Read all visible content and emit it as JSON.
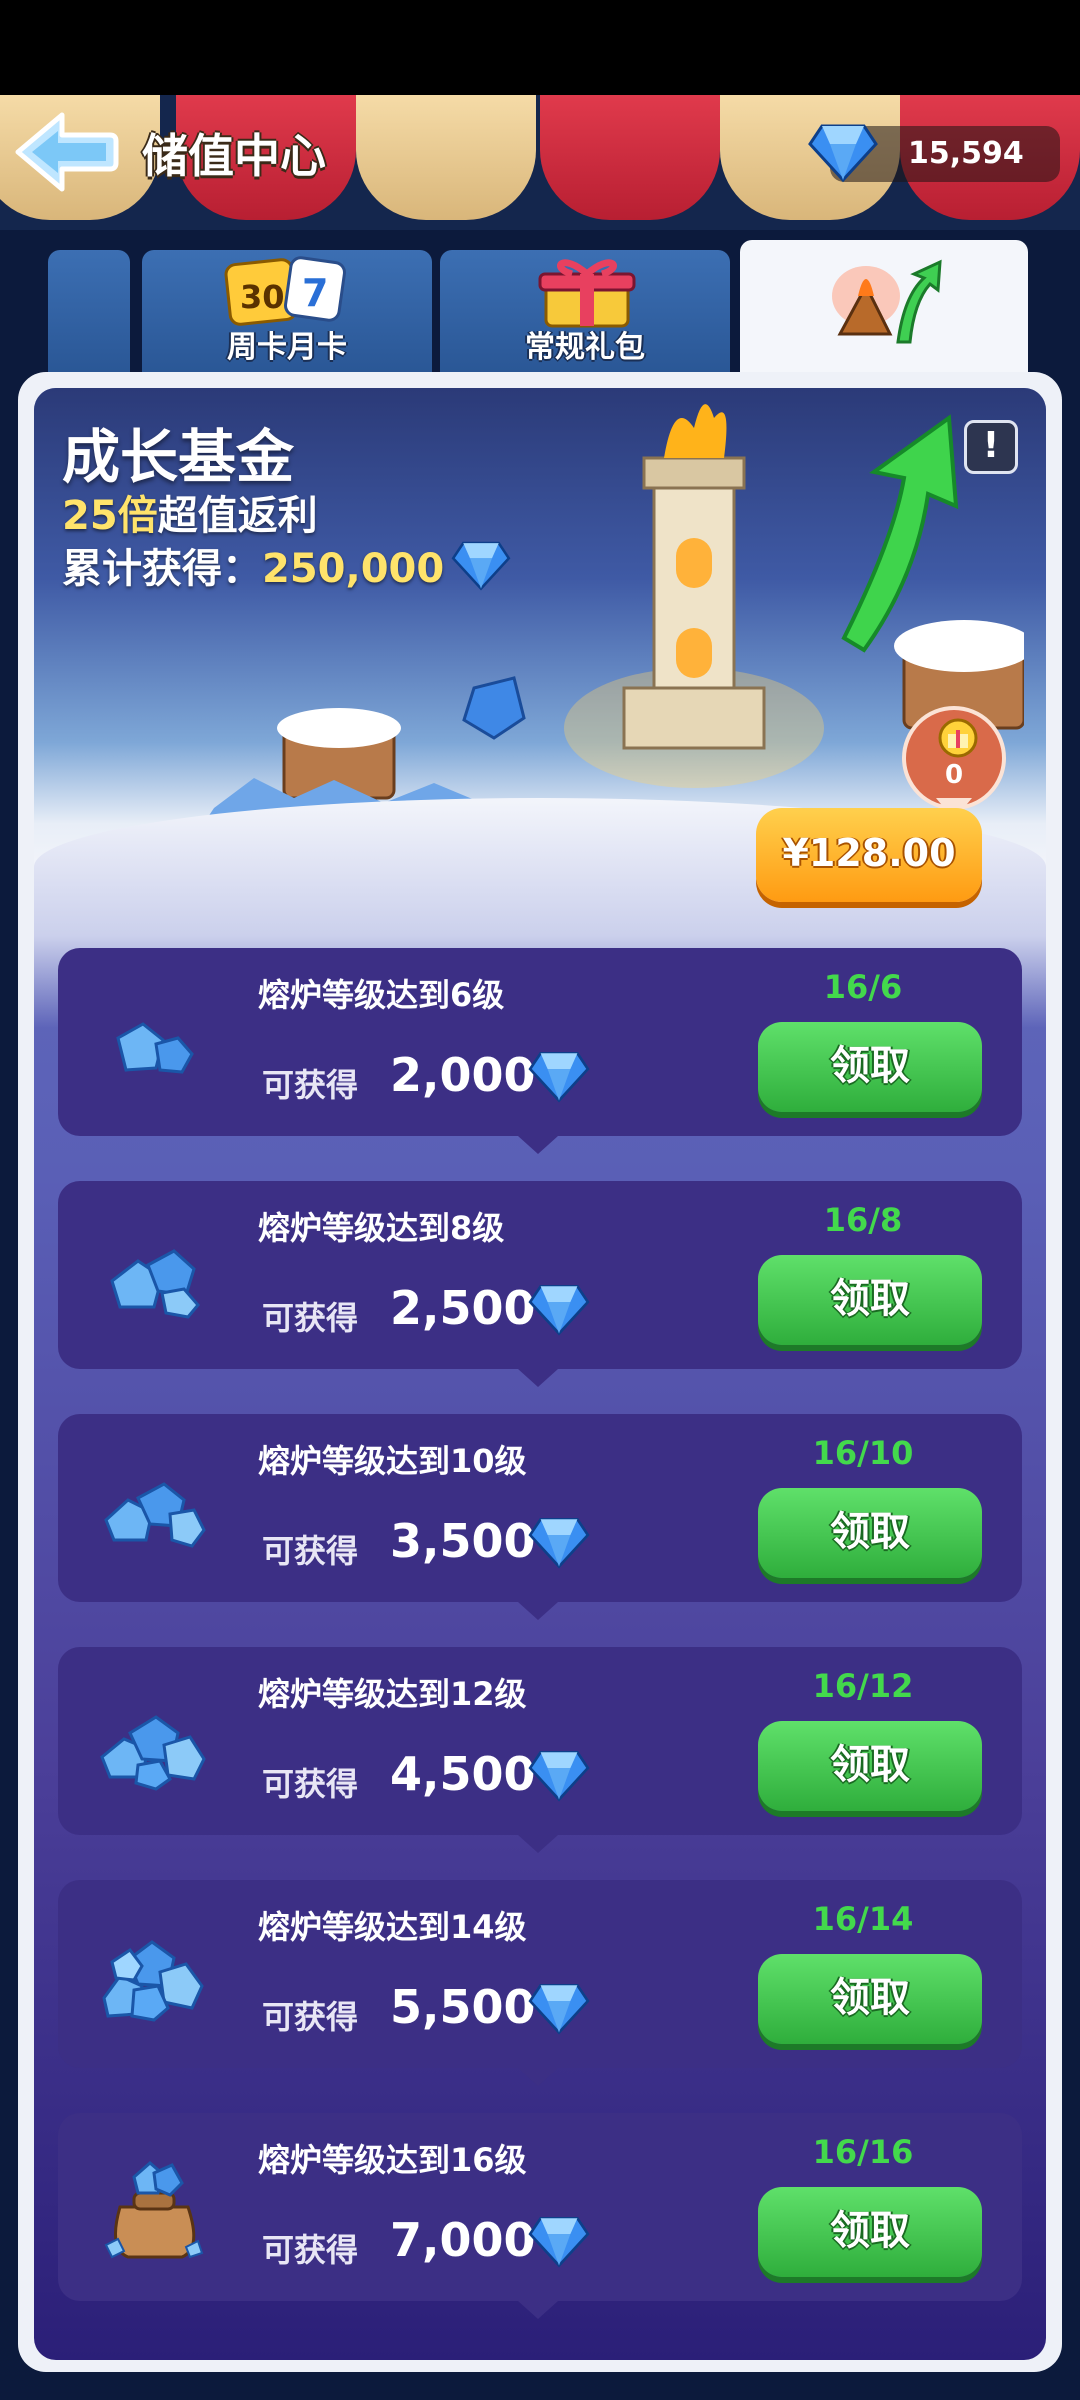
{
  "header": {
    "title": "储值中心",
    "currency_amount": "15,594",
    "colors": {
      "awning_red": "#c82a3e",
      "awning_cream": "#ecc98d"
    }
  },
  "tabs": [
    {
      "label": "周卡月卡",
      "icon": "calendar-30-7-icon"
    },
    {
      "label": "常规礼包",
      "icon": "gift-box-icon"
    },
    {
      "label": "",
      "icon": "growth-fund-icon",
      "active": true
    }
  ],
  "banner": {
    "title": "成长基金",
    "multiplier": "25倍",
    "multiplier_text": "超值返利",
    "total_label": "累计获得：",
    "total_value": "250,000",
    "price": "¥128.00",
    "gift_count": "0",
    "info_icon": "!"
  },
  "rewards": [
    {
      "condition": "熔炉等级达到6级",
      "gain_label": "可获得",
      "amount": "2,000",
      "progress": "16/6",
      "button": "领取",
      "icon": "gem-small-icon"
    },
    {
      "condition": "熔炉等级达到8级",
      "gain_label": "可获得",
      "amount": "2,500",
      "progress": "16/8",
      "button": "领取",
      "icon": "gem-pile-icon"
    },
    {
      "condition": "熔炉等级达到10级",
      "gain_label": "可获得",
      "amount": "3,500",
      "progress": "16/10",
      "button": "领取",
      "icon": "gem-pile-icon"
    },
    {
      "condition": "熔炉等级达到12级",
      "gain_label": "可获得",
      "amount": "4,500",
      "progress": "16/12",
      "button": "领取",
      "icon": "gem-pile-large-icon"
    },
    {
      "condition": "熔炉等级达到14级",
      "gain_label": "可获得",
      "amount": "5,500",
      "progress": "16/14",
      "button": "领取",
      "icon": "gem-heap-icon"
    },
    {
      "condition": "熔炉等级达到16级",
      "gain_label": "可获得",
      "amount": "7,000",
      "progress": "16/16",
      "button": "领取",
      "icon": "gem-bag-icon"
    }
  ]
}
